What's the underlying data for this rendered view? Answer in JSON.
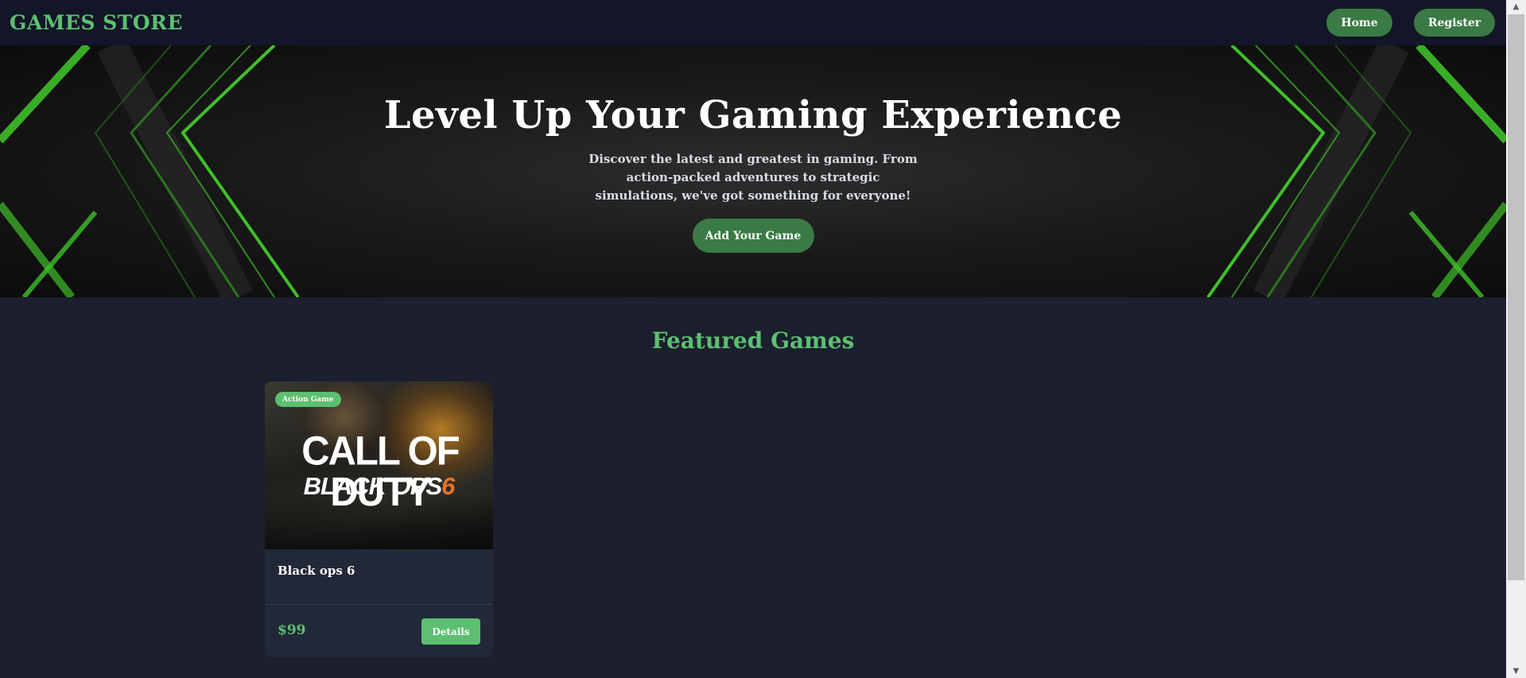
{
  "nav": {
    "logo": "GAMES STORE",
    "links": [
      {
        "label": "Home"
      },
      {
        "label": "Register"
      }
    ]
  },
  "hero": {
    "title": "Level Up Your Gaming Experience",
    "subtitle": "Discover the latest and greatest in gaming. From action-packed adventures to strategic simulations, we've got something for everyone!",
    "cta_label": "Add Your Game"
  },
  "featured": {
    "title": "Featured Games",
    "games": [
      {
        "category": "Action Game",
        "cover_line1": "CALL OF DUTY",
        "cover_line2": "BLACK OPS",
        "cover_number": "6",
        "name": "Black ops 6",
        "price": "$99",
        "details_label": "Details"
      }
    ]
  },
  "colors": {
    "accent_green": "#5cc070",
    "button_green": "#3a7a44",
    "background": "#1b1f2e",
    "navbar": "#131628",
    "card": "#222838"
  }
}
